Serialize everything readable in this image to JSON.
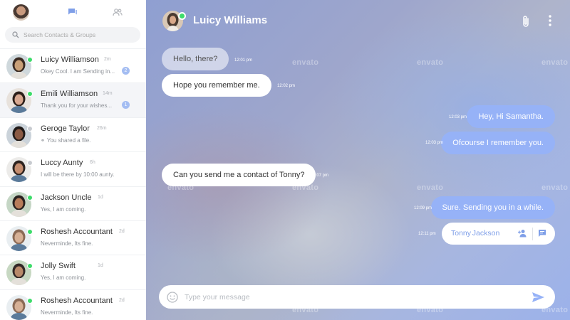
{
  "sidebar": {
    "search_placeholder": "Search Contacts & Groups",
    "contacts": [
      {
        "name": "Luicy Williamson",
        "time": "2m",
        "message": "Okey Cool. I am Sending in...",
        "badge": "2",
        "online": true,
        "active": false
      },
      {
        "name": "Emili Williamson",
        "time": "14m",
        "message": "Thank you for your wishes...",
        "badge": "1",
        "online": true,
        "active": true
      },
      {
        "name": "Geroge Taylor",
        "time": "26m",
        "message": "You shared a file.",
        "badge": "",
        "online": false,
        "active": false
      },
      {
        "name": "Luccy Aunty",
        "time": "6h",
        "message": "I will be there by 10:00 aunty.",
        "badge": "",
        "online": false,
        "active": false
      },
      {
        "name": "Jackson Uncle",
        "time": "1d",
        "message": "Yes, I am coming.",
        "badge": "",
        "online": true,
        "active": false
      },
      {
        "name": "Roshesh Accountant",
        "time": "2d",
        "message": "Neverminde, Its fine.",
        "badge": "",
        "online": true,
        "active": false
      },
      {
        "name": "Jolly Swift",
        "time": "1d",
        "message": "Yes, I am coming.",
        "badge": "",
        "online": true,
        "active": false
      },
      {
        "name": "Roshesh Accountant",
        "time": "2d",
        "message": "Neverminde, Its fine.",
        "badge": "",
        "online": true,
        "active": false
      }
    ]
  },
  "chat": {
    "title": "Luicy Williams",
    "messages": [
      {
        "direction": "in",
        "text": "Hello, there?",
        "time": "12:01 pm"
      },
      {
        "direction": "in",
        "text": "Hope you remember me.",
        "time": "12:02 pm"
      },
      {
        "direction": "out",
        "text": "Hey, Hi Samantha.",
        "time": "12:03 pm"
      },
      {
        "direction": "out",
        "text": "Ofcourse I remember you.",
        "time": "12:03 pm"
      },
      {
        "direction": "in",
        "text": "Can you send me a contact of Tonny?",
        "time": "12:07 pm"
      },
      {
        "direction": "out",
        "text": "Sure. Sending you in a while.",
        "time": "12:09 pm"
      }
    ],
    "contact_card": {
      "name": "Tonny Jackson",
      "time": "12:11 pm"
    },
    "composer_placeholder": "Type your message",
    "watermark": "envato"
  },
  "colors": {
    "accent": "#96b2f7",
    "online": "#3ddc6a",
    "offline": "#c8cbd0"
  },
  "icons": [
    "chats-icon",
    "contacts-icon",
    "search-icon",
    "paperclip-icon",
    "more-vertical-icon",
    "add-contact-icon",
    "message-icon",
    "emoji-icon",
    "send-icon",
    "attachment-small-icon"
  ]
}
